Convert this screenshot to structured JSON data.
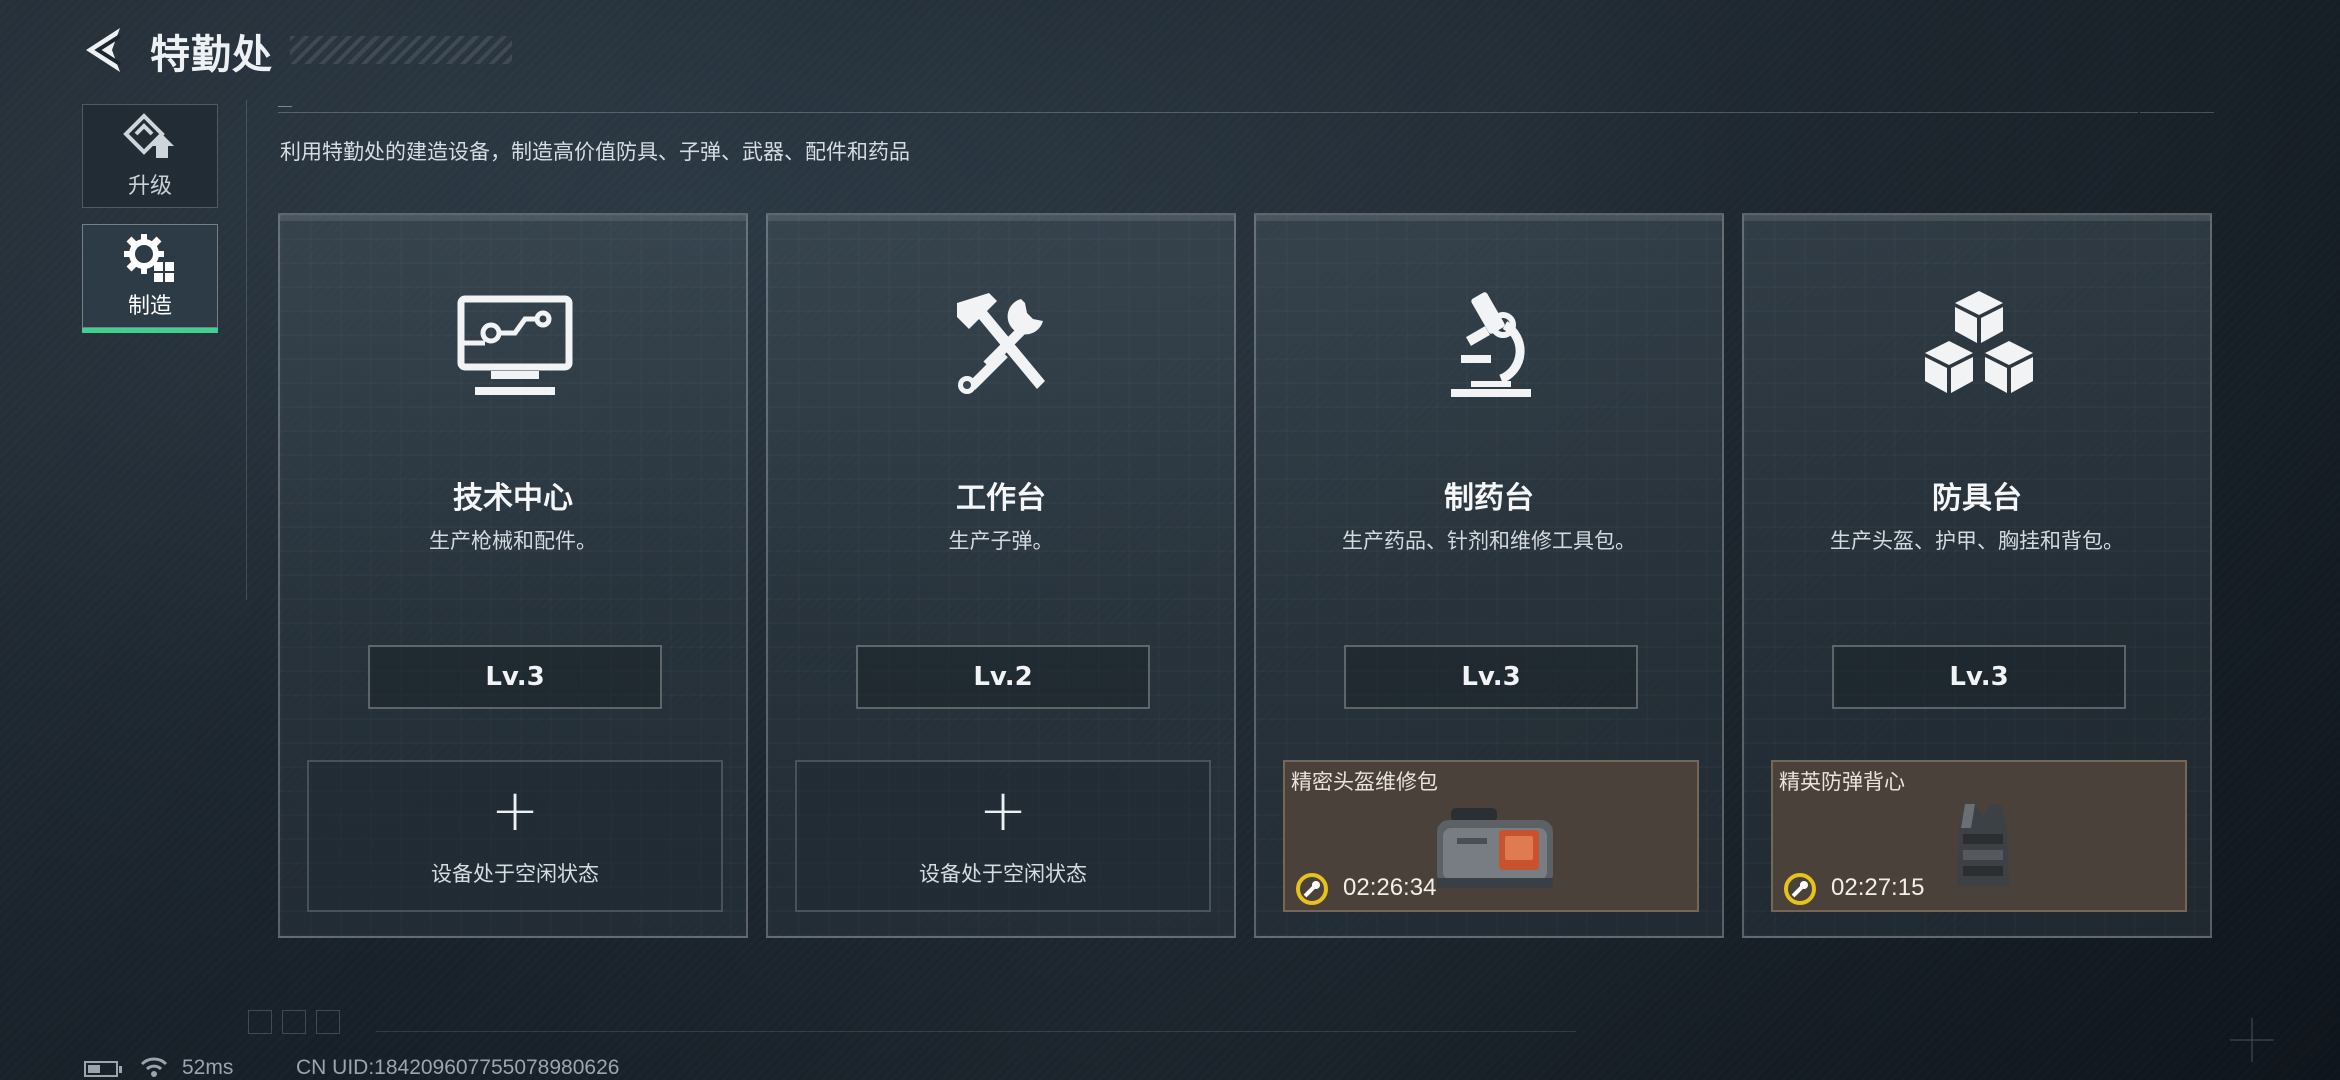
{
  "header": {
    "title": "特勤处"
  },
  "sidebar": {
    "items": [
      {
        "label": "升级",
        "icon": "upgrade-icon",
        "active": false
      },
      {
        "label": "制造",
        "icon": "gear-grid-icon",
        "active": true
      }
    ]
  },
  "main": {
    "subtitle": "利用特勤处的建造设备，制造高价值防具、子弹、武器、配件和药品",
    "stations": [
      {
        "name": "技术中心",
        "desc": "生产枪械和配件。",
        "icon": "monitor-icon",
        "level": "Lv.3",
        "slot": {
          "state": "idle",
          "text": "设备处于空闲状态"
        }
      },
      {
        "name": "工作台",
        "desc": "生产子弹。",
        "icon": "hammer-wrench-icon",
        "level": "Lv.2",
        "slot": {
          "state": "idle",
          "text": "设备处于空闲状态"
        }
      },
      {
        "name": "制药台",
        "desc": "生产药品、针剂和维修工具包。",
        "icon": "microscope-icon",
        "level": "Lv.3",
        "slot": {
          "state": "active",
          "item": "精密头盔维修包",
          "timer": "02:26:34",
          "item_icon": "repair-bag-icon"
        }
      },
      {
        "name": "防具台",
        "desc": "生产头盔、护甲、胸挂和背包。",
        "icon": "cubes-icon",
        "level": "Lv.3",
        "slot": {
          "state": "active",
          "item": "精英防弹背心",
          "timer": "02:27:15",
          "item_icon": "vest-icon"
        }
      }
    ]
  },
  "status": {
    "ping": "52ms",
    "uid": "CN UID:1842096077550789806​26"
  },
  "colors": {
    "accent": "#3fd18f",
    "timer_ring": "#e6c21a",
    "active_slot": "#4a423a"
  }
}
